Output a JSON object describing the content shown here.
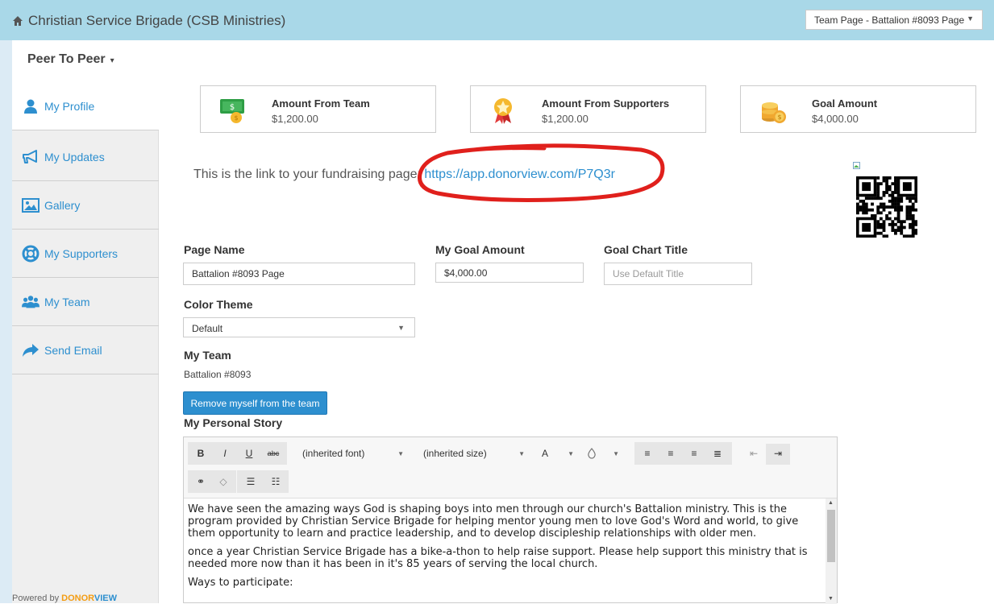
{
  "header": {
    "org_name": "Christian Service Brigade (CSB Ministries)",
    "page_select_value": "Team Page - Battalion #8093 Page"
  },
  "nav": {
    "module_label": "Peer To Peer"
  },
  "sidebar": {
    "items": [
      {
        "label": "My Profile",
        "icon": "user-icon"
      },
      {
        "label": "My Updates",
        "icon": "megaphone-icon"
      },
      {
        "label": "Gallery",
        "icon": "image-icon"
      },
      {
        "label": "My Supporters",
        "icon": "lifebuoy-icon"
      },
      {
        "label": "My Team",
        "icon": "group-icon"
      },
      {
        "label": "Send Email",
        "icon": "share-icon"
      }
    ],
    "powered_by": "Powered by",
    "powered_brand_a": "DONOR",
    "powered_brand_b": "VIEW"
  },
  "stats": [
    {
      "label": "Amount From Team",
      "value": "$1,200.00",
      "icon": "money-icon"
    },
    {
      "label": "Amount From Supporters",
      "value": "$1,200.00",
      "icon": "award-icon"
    },
    {
      "label": "Goal Amount",
      "value": "$4,000.00",
      "icon": "coins-icon"
    }
  ],
  "link": {
    "prefix": "This is the link to your fundraising page:",
    "url": "https://app.donorview.com/P7Q3r"
  },
  "form": {
    "page_name_label": "Page Name",
    "page_name_value": "Battalion #8093 Page",
    "goal_amount_label": "My Goal Amount",
    "goal_amount_value": "$4,000.00",
    "goal_chart_title_label": "Goal Chart Title",
    "goal_chart_title_placeholder": "Use Default Title",
    "color_theme_label": "Color Theme",
    "color_theme_value": "Default",
    "my_team_label": "My Team",
    "my_team_value": "Battalion #8093",
    "remove_button": "Remove myself from the team",
    "story_label": "My Personal Story"
  },
  "editor": {
    "bold": "B",
    "italic": "I",
    "underline": "U",
    "strike": "abc",
    "font_value": "(inherited font)",
    "size_value": "(inherited size)",
    "text_color": "A",
    "paragraphs": [
      "We have seen the amazing ways God is shaping boys into men through our church's Battalion ministry. This is the program provided by Christian Service Brigade for helping mentor young men to love God's Word and world, to give them opportunity to learn and practice leadership, and to develop discipleship relationships with older men.",
      "once a year Christian Service Brigade has a bike-a-thon to help raise support. Please help support this ministry that is needed more now than it has been in it's 85 years of serving the local church.",
      "Ways to participate:"
    ]
  },
  "colors": {
    "topbar": "#a9d8e8",
    "link": "#2d8fcf",
    "annotation": "#e0201c"
  }
}
